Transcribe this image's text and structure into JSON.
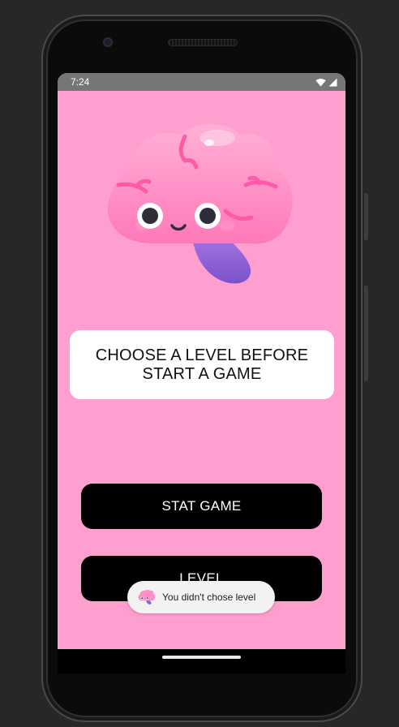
{
  "status_bar": {
    "time": "7:24",
    "icons": [
      "wifi-icon",
      "signal-icon",
      "battery-icon"
    ]
  },
  "mascot": {
    "icon": "brain-mascot-icon"
  },
  "banner": {
    "text": "CHOOSE A LEVEL BEFORE START A GAME"
  },
  "buttons": {
    "start_label": "STAT GAME",
    "level_label": "LEVEL"
  },
  "toast": {
    "icon": "brain-mascot-icon",
    "message": "You didn't chose level"
  },
  "colors": {
    "background": "#ff9fd0",
    "button": "#000000",
    "button_text": "#ffffff",
    "banner": "#ffffff",
    "status_bar": "#767676"
  }
}
